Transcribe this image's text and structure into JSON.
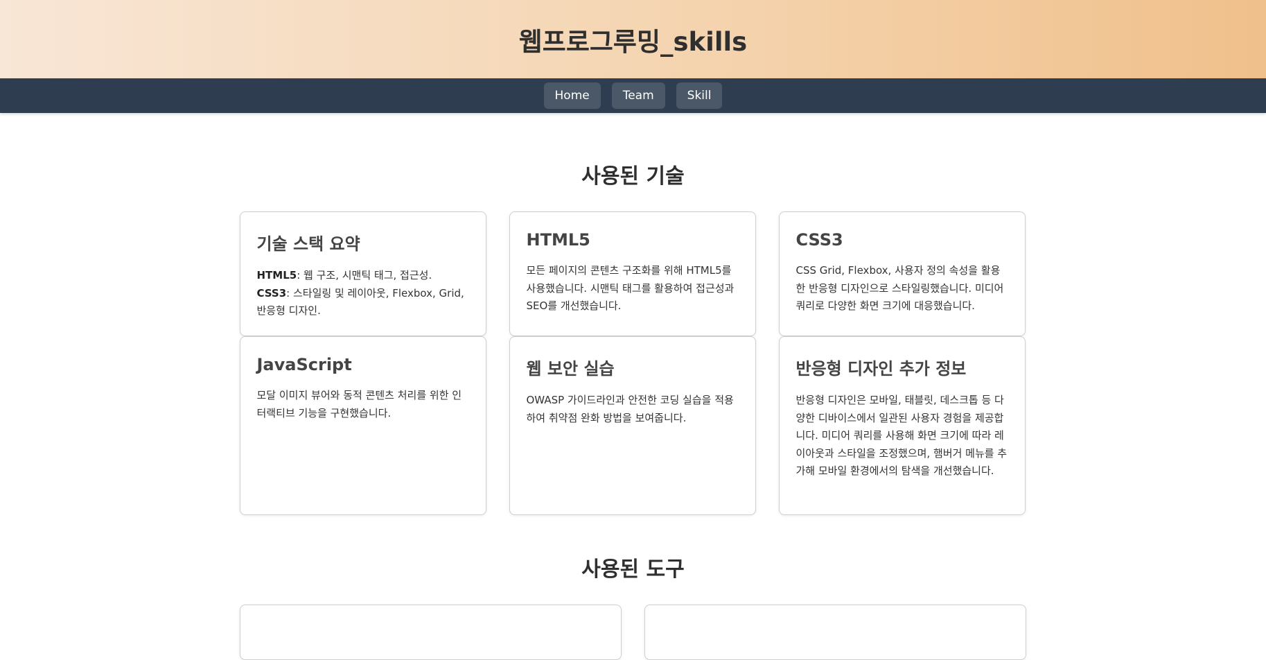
{
  "header": {
    "title": "웹프로그루밍_skills"
  },
  "nav": {
    "items": [
      "Home",
      "Team",
      "Skill"
    ]
  },
  "skills_section": {
    "title": "사용된 기술",
    "cards": [
      {
        "title": "기술 스택 요약",
        "line1_label": "HTML5",
        "line1_text": ": 웹 구조, 시맨틱 태그, 접근성.",
        "line2_label": "CSS3",
        "line2_text": ": 스타일링 및 레이아웃, Flexbox, Grid, 반응형 디자인."
      },
      {
        "title": "HTML5",
        "text": "모든 페이지의 콘텐츠 구조화를 위해 HTML5를 사용했습니다. 시맨틱 태그를 활용하여 접근성과 SEO를 개선했습니다."
      },
      {
        "title": "CSS3",
        "text": "CSS Grid, Flexbox, 사용자 정의 속성을 활용한 반응형 디자인으로 스타일링했습니다. 미디어 쿼리로 다양한 화면 크기에 대응했습니다."
      },
      {
        "title": "JavaScript",
        "text": "모달 이미지 뷰어와 동적 콘텐츠 처리를 위한 인터랙티브 기능을 구현했습니다."
      },
      {
        "title": "웹 보안 실습",
        "text": "OWASP 가이드라인과 안전한 코딩 실습을 적용하여 취약점 완화 방법을 보여줍니다."
      },
      {
        "title": "반응형 디자인 추가 정보",
        "text": "반응형 디자인은 모바일, 태블릿, 데스크톱 등 다양한 디바이스에서 일관된 사용자 경험을 제공합니다. 미디어 쿼리를 사용해 화면 크기에 따라 레이아웃과 스타일을 조정했으며, 햄버거 메뉴를 추가해 모바일 환경에서의 탐색을 개선했습니다."
      }
    ]
  },
  "tools_section": {
    "title": "사용된 도구"
  }
}
